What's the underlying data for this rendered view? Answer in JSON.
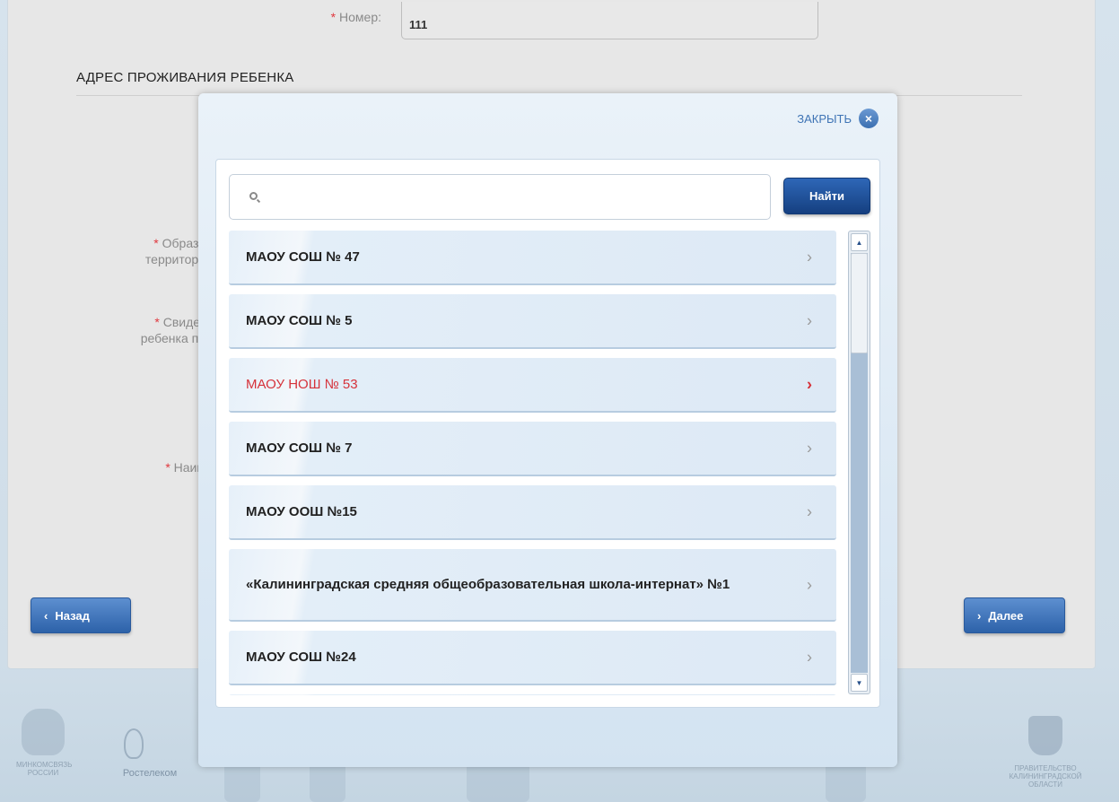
{
  "form": {
    "number_label": "Номер:",
    "number_value": "111",
    "required_mark": "*",
    "section_title": "АДРЕС ПРОЖИВАНИЯ РЕБЕНКА",
    "label_education_1": "Образо",
    "label_education_2": "территори",
    "label_certificate_1": "Свидет",
    "label_certificate_2": "ребенка по",
    "label_name": "Наим",
    "back_button": "Назад",
    "next_button": "Далее"
  },
  "footer": {
    "ministry_text": "МИНКОМСВЯЗЬ РОССИИ",
    "rostelecom_text": "Ростелеком",
    "government_text": "ПРАВИТЕЛЬСТВО КАЛИНИНГРАДСКОЙ ОБЛАСТИ"
  },
  "modal": {
    "close_label": "ЗАКРЫТЬ",
    "search_placeholder": "",
    "search_value": "",
    "find_button": "Найти",
    "items": [
      {
        "label": "МАОУ СОШ № 47",
        "active": false
      },
      {
        "label": "МАОУ СОШ № 5",
        "active": false
      },
      {
        "label": "МАОУ НОШ № 53",
        "active": true
      },
      {
        "label": "МАОУ СОШ № 7",
        "active": false
      },
      {
        "label": "МАОУ ООШ №15",
        "active": false
      },
      {
        "label": "«Калининградская средняя общеобразовательная школа-интернат» №1",
        "active": false
      },
      {
        "label": "МАОУ СОШ №24",
        "active": false
      }
    ]
  },
  "colors": {
    "accent_blue": "#2d62a9",
    "active_red": "#d6323a",
    "required_red": "#e0383e"
  }
}
